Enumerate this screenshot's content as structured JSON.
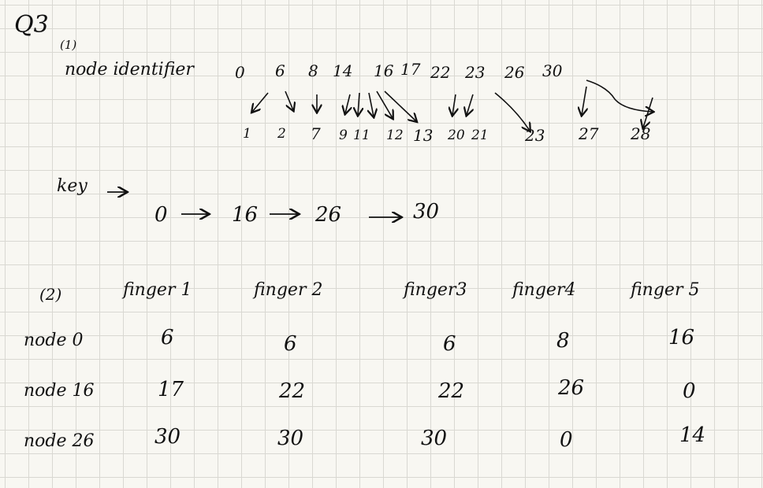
{
  "title": "Q3",
  "part1": {
    "label": "(1)",
    "node_identifier_label": "node identifier",
    "node_ids": [
      "0",
      "6",
      "8",
      "14",
      "16",
      "17",
      "22",
      "23",
      "26",
      "30"
    ],
    "key_values": [
      "1",
      "2",
      "7",
      "9",
      "11",
      "12",
      "13",
      "20",
      "21",
      "23",
      "27",
      "28"
    ],
    "key_label": "key",
    "route": [
      "0",
      "16",
      "26",
      "30"
    ]
  },
  "part2": {
    "label": "(2)",
    "headers": [
      "finger 1",
      "finger 2",
      "finger3",
      "finger4",
      "finger 5"
    ],
    "rows": [
      {
        "name": "node 0",
        "values": [
          "6",
          "6",
          "6",
          "8",
          "16"
        ]
      },
      {
        "name": "node 16",
        "values": [
          "17",
          "22",
          "22",
          "26",
          "0"
        ]
      },
      {
        "name": "node 26",
        "values": [
          "30",
          "30",
          "30",
          "0",
          "14"
        ]
      }
    ]
  }
}
